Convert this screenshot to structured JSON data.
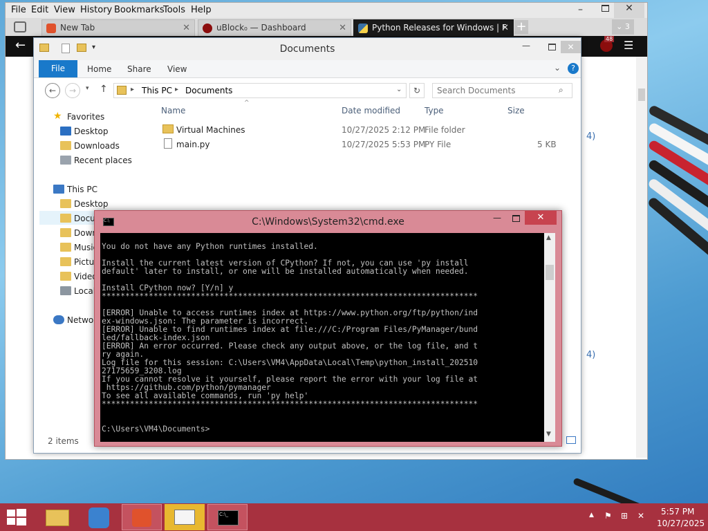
{
  "browser": {
    "menu": [
      "File",
      "Edit",
      "View",
      "History",
      "Bookmarks",
      "Tools",
      "Help"
    ],
    "tabs": [
      {
        "label": "New Tab",
        "icon": "firefox-fox-icon",
        "color": "#e0522c"
      },
      {
        "label": "uBlock₀ — Dashboard",
        "icon": "ublock-shield-icon",
        "color": "#8b0d0d"
      },
      {
        "label": "Python Releases for Windows | F",
        "icon": "python-icon",
        "color": "#3a72a6"
      }
    ],
    "tab_count": "3",
    "ublock_badge": "48",
    "page_fragments": [
      "4)",
      "4)"
    ]
  },
  "explorer": {
    "title": "Documents",
    "ribbon_tabs": [
      "File",
      "Home",
      "Share",
      "View"
    ],
    "address": {
      "root": "This PC",
      "current": "Documents"
    },
    "search_placeholder": "Search Documents",
    "favorites": {
      "header": "Favorites",
      "items": [
        "Desktop",
        "Downloads",
        "Recent places"
      ]
    },
    "thispc": {
      "header": "This PC",
      "items": [
        "Desktop",
        "Docu",
        "Down",
        "Music",
        "Pictur",
        "Video",
        "Local"
      ]
    },
    "network": "Networ",
    "columns": [
      "Name",
      "Date modified",
      "Type",
      "Size"
    ],
    "files": [
      {
        "name": "Virtual Machines",
        "date": "10/27/2025 2:12 PM",
        "type": "File folder",
        "size": ""
      },
      {
        "name": "main.py",
        "date": "10/27/2025 5:53 PM",
        "type": "PY File",
        "size": "5 KB"
      }
    ],
    "status": "2 items"
  },
  "cmd": {
    "title": "C:\\Windows\\System32\\cmd.exe",
    "lines": [
      "",
      "You do not have any Python runtimes installed.",
      "",
      "Install the current latest version of CPython? If not, you can use 'py install",
      "default' later to install, or one will be installed automatically when needed.",
      "",
      "Install CPython now? [Y/n] y",
      "********************************************************************************",
      "",
      "[ERROR] Unable to access runtimes index at https://www.python.org/ftp/python/ind",
      "ex-windows.json: The parameter is incorrect.",
      "[ERROR] Unable to find runtimes index at file:///C:/Program Files/PyManager/bund",
      "led/fallback-index.json",
      "[ERROR] An error occurred. Please check any output above, or the log file, and t",
      "ry again.",
      "Log file for this session: C:\\Users\\VM4\\AppData\\Local\\Temp\\python_install_202510",
      "27175659_3208.log",
      "If you cannot resolve it yourself, please report the error with your log file at",
      " https://github.com/python/pymanager",
      "To see all available commands, run 'py help'",
      "********************************************************************************",
      "",
      "",
      "C:\\Users\\VM4\\Documents>"
    ]
  },
  "taskbar": {
    "apps": [
      "file-explorer",
      "magnifier",
      "firefox",
      "printer",
      "command-prompt"
    ],
    "time": "5:57 PM",
    "date": "10/27/2025"
  }
}
